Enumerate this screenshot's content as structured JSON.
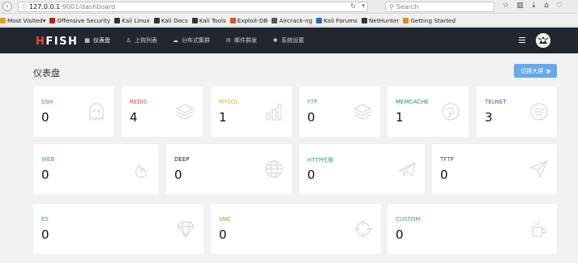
{
  "browser": {
    "url_host": "127.0.0.1",
    "url_path": ":9001/dashboard",
    "search_placeholder": "Search",
    "bookmarks": [
      {
        "label": "Most Visited",
        "color": "#e59a2a",
        "dropdown": true
      },
      {
        "label": "Offensive Security",
        "color": "#b3261e"
      },
      {
        "label": "Kali Linux",
        "color": "#333333"
      },
      {
        "label": "Kali Docs",
        "color": "#333333"
      },
      {
        "label": "Kali Tools",
        "color": "#333333"
      },
      {
        "label": "Exploit-DB",
        "color": "#d9531e"
      },
      {
        "label": "Aircrack-ng",
        "color": "#555555"
      },
      {
        "label": "Kali Forums",
        "color": "#2a68c2"
      },
      {
        "label": "NetHunter",
        "color": "#333333"
      },
      {
        "label": "Getting Started",
        "color": "#e08a1e"
      }
    ]
  },
  "header": {
    "logo_h": "H",
    "logo_rest": "FISH",
    "nav": [
      {
        "label": "仪表盘",
        "icon": "dashboard-icon",
        "active": true
      },
      {
        "label": "上钩列表",
        "icon": "fish-icon"
      },
      {
        "label": "分布式集群",
        "icon": "cloud-icon"
      },
      {
        "label": "邮件群发",
        "icon": "mail-icon"
      },
      {
        "label": "系统设置",
        "icon": "gear-icon"
      }
    ]
  },
  "main": {
    "title": "仪表盘",
    "big_screen_button": "切换大屏 ◑"
  },
  "cards": [
    {
      "label": "SSH",
      "value": "0",
      "color": "#a24bc6",
      "icon": "ghost-icon"
    },
    {
      "label": "REDIS",
      "value": "4",
      "color": "#d9443a",
      "icon": "layers-icon"
    },
    {
      "label": "MYSQL",
      "value": "1",
      "color": "#e2b538",
      "icon": "bar-chart-icon"
    },
    {
      "label": "FTP",
      "value": "0",
      "color": "#3bb56a",
      "icon": "layers-icon"
    },
    {
      "label": "MEMCACHE",
      "value": "1",
      "color": "#2f8a80",
      "icon": "pinterest-icon"
    },
    {
      "label": "TELNET",
      "value": "3",
      "color": "#555a96",
      "icon": "spotify-icon"
    },
    {
      "label": "WEB",
      "value": "0",
      "color": "#3a8ee0",
      "icon": "fire-icon"
    },
    {
      "label": "DEEP",
      "value": "0",
      "color": "#222222",
      "icon": "globe-icon"
    },
    {
      "label": "HTTP代理",
      "value": "0",
      "color": "#3aa17a",
      "icon": "plane-icon"
    },
    {
      "label": "TFTP",
      "value": "0",
      "color": "#44477e",
      "icon": "send-icon"
    },
    {
      "label": "ES",
      "value": "0",
      "color": "#3a8ee0",
      "icon": "diamond-icon"
    },
    {
      "label": "VNC",
      "value": "0",
      "color": "#c0821c",
      "icon": "crosshair-icon"
    },
    {
      "label": "CUSTOM",
      "value": "0",
      "color": "#3aa17a",
      "icon": "coffee-icon"
    }
  ]
}
